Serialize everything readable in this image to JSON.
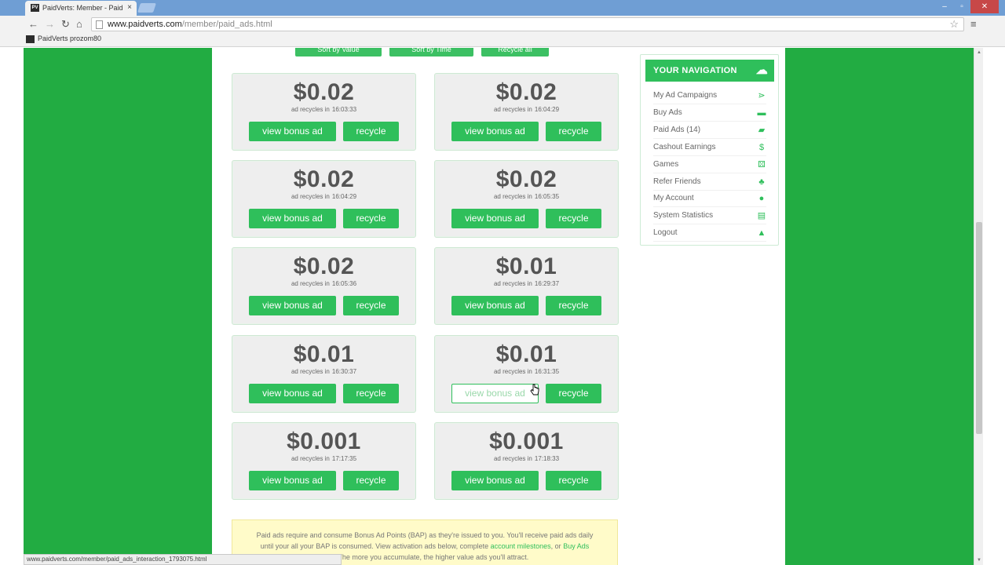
{
  "browser": {
    "tab_title": "PaidVerts: Member - Paid",
    "favicon_text": "PV",
    "tab_close": "×",
    "window_controls": [
      "‒",
      "▫",
      "✕"
    ],
    "url_host": "www.paidverts.com",
    "url_path": "/member/paid_ads.html",
    "bookmark_label": "PaidVerts prozom80",
    "back": "←",
    "forward": "→",
    "reload": "↻",
    "home": "⌂",
    "star": "☆",
    "menu": "≡",
    "status_url": "www.paidverts.com/member/paid_ads_interaction_1793075.html"
  },
  "top_buttons": [
    "Sort by Value",
    "Sort by Time",
    "Recycle all"
  ],
  "ads": [
    {
      "amount": "$0.02",
      "note": "ad recycles in",
      "time": "16:03:33",
      "view_label": "view bonus ad",
      "recycle_label": "recycle"
    },
    {
      "amount": "$0.02",
      "note": "ad recycles in",
      "time": "16:04:29",
      "view_label": "view bonus ad",
      "recycle_label": "recycle"
    },
    {
      "amount": "$0.02",
      "note": "ad recycles in",
      "time": "16:04:29",
      "view_label": "view bonus ad",
      "recycle_label": "recycle"
    },
    {
      "amount": "$0.02",
      "note": "ad recycles in",
      "time": "16:05:35",
      "view_label": "view bonus ad",
      "recycle_label": "recycle"
    },
    {
      "amount": "$0.02",
      "note": "ad recycles in",
      "time": "16:05:36",
      "view_label": "view bonus ad",
      "recycle_label": "recycle"
    },
    {
      "amount": "$0.01",
      "note": "ad recycles in",
      "time": "16:29:37",
      "view_label": "view bonus ad",
      "recycle_label": "recycle"
    },
    {
      "amount": "$0.01",
      "note": "ad recycles in",
      "time": "16:30:37",
      "view_label": "view bonus ad",
      "recycle_label": "recycle"
    },
    {
      "amount": "$0.01",
      "note": "ad recycles in",
      "time": "16:31:35",
      "view_label": "view bonus ad",
      "recycle_label": "recycle"
    },
    {
      "amount": "$0.001",
      "note": "ad recycles in",
      "time": "17:17:35",
      "view_label": "view bonus ad",
      "recycle_label": "recycle"
    },
    {
      "amount": "$0.001",
      "note": "ad recycles in",
      "time": "17:18:33",
      "view_label": "view bonus ad",
      "recycle_label": "recycle"
    }
  ],
  "info": {
    "line1": "Paid ads require and consume Bonus Ad Points (BAP) as they're issued to you. You'll receive paid ads daily",
    "line2_pre": "until your all your BAP is consumed. View activation ads below, complete",
    "link1": "account milestones",
    "line2_mid": ", or",
    "link2": "Buy Ads",
    "line3": "BAP. The more you accumulate, the higher value ads you'll attract."
  },
  "navigation": {
    "header": "YOUR NAVIGATION",
    "items": [
      {
        "label": "My Ad Campaigns",
        "icon": "share-icon",
        "glyph": "⋗"
      },
      {
        "label": "Buy Ads",
        "icon": "card-icon",
        "glyph": "▬"
      },
      {
        "label": "Paid Ads (14)",
        "icon": "truck-icon",
        "glyph": "▰"
      },
      {
        "label": "Cashout Earnings",
        "icon": "dollar-icon",
        "glyph": "$"
      },
      {
        "label": "Games",
        "icon": "dice-icon",
        "glyph": "⚄"
      },
      {
        "label": "Refer Friends",
        "icon": "network-icon",
        "glyph": "♣"
      },
      {
        "label": "My Account",
        "icon": "user-icon",
        "glyph": "●"
      },
      {
        "label": "System Statistics",
        "icon": "chart-icon",
        "glyph": "▤"
      },
      {
        "label": "Logout",
        "icon": "logout-icon",
        "glyph": "▲"
      }
    ]
  },
  "colors": {
    "page_green": "#22ac42",
    "button_green": "#2fbf5b",
    "card_gray": "#eeeeee",
    "info_yellow": "#fffbc9"
  }
}
